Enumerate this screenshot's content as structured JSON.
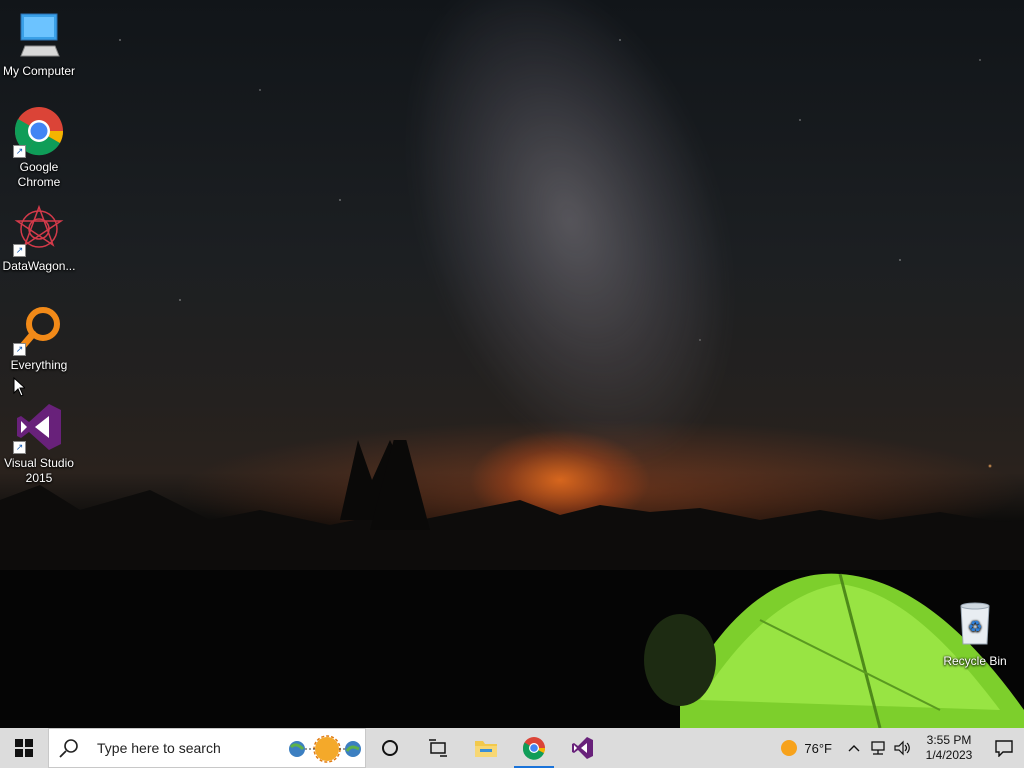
{
  "desktop": {
    "icons": [
      {
        "label": "My Computer",
        "icon": "computer-icon"
      },
      {
        "label": "Google Chrome",
        "icon": "chrome-icon"
      },
      {
        "label": "DataWagon...",
        "icon": "datawagon-icon"
      },
      {
        "label": "Everything",
        "icon": "everything-icon"
      },
      {
        "label": "Visual Studio 2015",
        "icon": "visual-studio-icon"
      },
      {
        "label": "Recycle Bin",
        "icon": "recycle-bin-icon"
      }
    ]
  },
  "taskbar": {
    "search_placeholder": "Type here to search",
    "pinned": [
      {
        "name": "cortana",
        "icon": "cortana-circle-icon"
      },
      {
        "name": "task-view",
        "icon": "task-view-icon"
      },
      {
        "name": "file-explorer",
        "icon": "folder-icon"
      },
      {
        "name": "chrome",
        "icon": "chrome-icon",
        "active": true
      },
      {
        "name": "visual-studio",
        "icon": "visual-studio-icon"
      }
    ],
    "tray": {
      "weather_temp": "76°F",
      "time": "3:55 PM",
      "date": "1/4/2023"
    }
  },
  "colors": {
    "taskbar_bg": "#dcdcdc",
    "active_indicator": "#1a73d9",
    "tent_green": "#8ee03a",
    "vs_purple": "#68217a"
  }
}
